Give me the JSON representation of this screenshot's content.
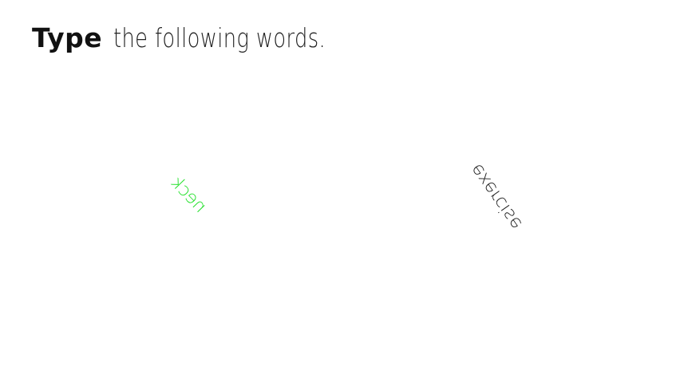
{
  "instruction": {
    "emphasis": "Type",
    "rest": "the following words."
  },
  "words": [
    {
      "text": "neck",
      "color": "#22e02a",
      "mirrored": true,
      "rotation_deg": -46
    },
    {
      "text": "exercise",
      "color": "#1a1a1a",
      "mirrored": true,
      "rotation_deg": 125
    }
  ]
}
